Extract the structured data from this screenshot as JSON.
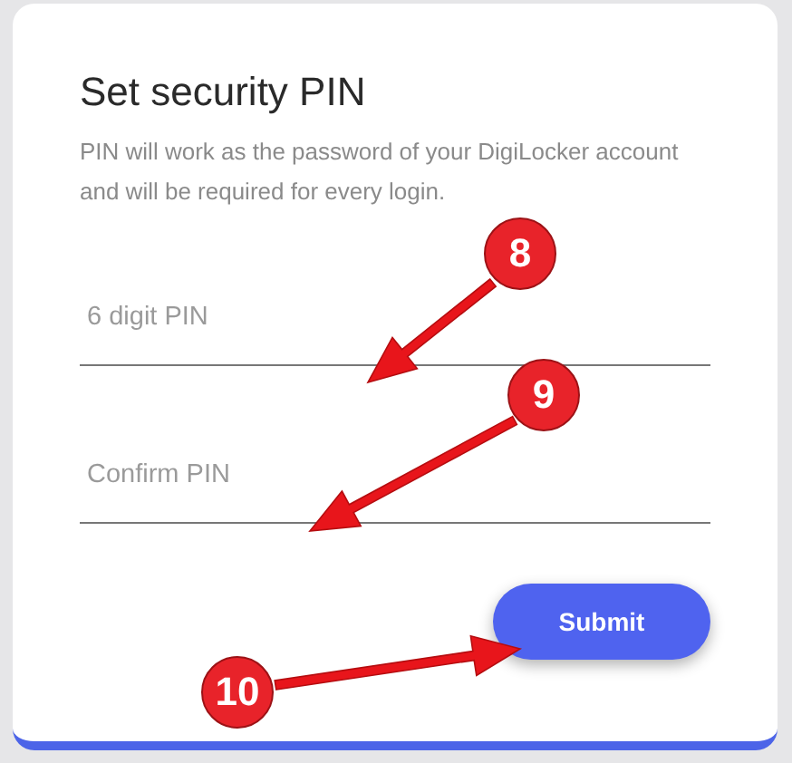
{
  "card": {
    "title": "Set security PIN",
    "description": "PIN will work as the password of your DigiLocker account and will be required for every login."
  },
  "fields": [
    {
      "placeholder": "6 digit PIN"
    },
    {
      "placeholder": "Confirm PIN"
    }
  ],
  "submit_button": "Submit",
  "annotations": [
    {
      "label": "8"
    },
    {
      "label": "9"
    },
    {
      "label": "10"
    }
  ]
}
